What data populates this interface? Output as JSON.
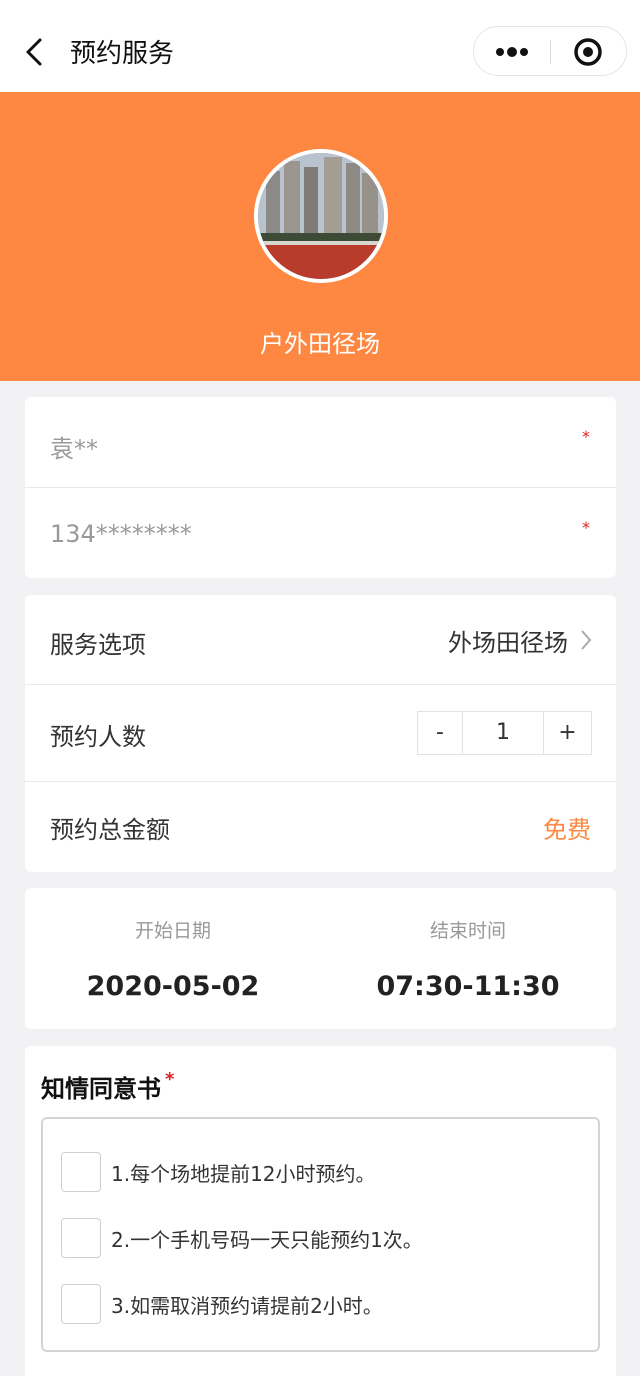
{
  "nav": {
    "title": "预约服务"
  },
  "banner": {
    "venue_name": "户外田径场"
  },
  "contact": {
    "name_value": "袁**",
    "phone_value": "134********",
    "required_mark": "*"
  },
  "service": {
    "option_label": "服务选项",
    "option_value": "外场田径场",
    "people_label": "预约人数",
    "people_count": "1",
    "minus_label": "-",
    "plus_label": "+",
    "total_label": "预约总金额",
    "total_value": "免费"
  },
  "schedule": {
    "start_label": "开始日期",
    "start_value": "2020-05-02",
    "end_label": "结束时间",
    "end_value": "07:30-11:30"
  },
  "consent": {
    "title": "知情同意书",
    "required_mark": "*",
    "items": [
      {
        "text": "1.每个场地提前12小时预约。"
      },
      {
        "text": "2.一个手机号码一天只能预约1次。"
      },
      {
        "text": "3.如需取消预约请提前2小时。"
      }
    ]
  },
  "colors": {
    "accent": "#fe8842",
    "required": "#e02020",
    "background": "#f2f2f4"
  },
  "icons": [
    "back-icon",
    "more-icon",
    "target-icon",
    "chevron-right-icon",
    "checkbox-icon"
  ]
}
